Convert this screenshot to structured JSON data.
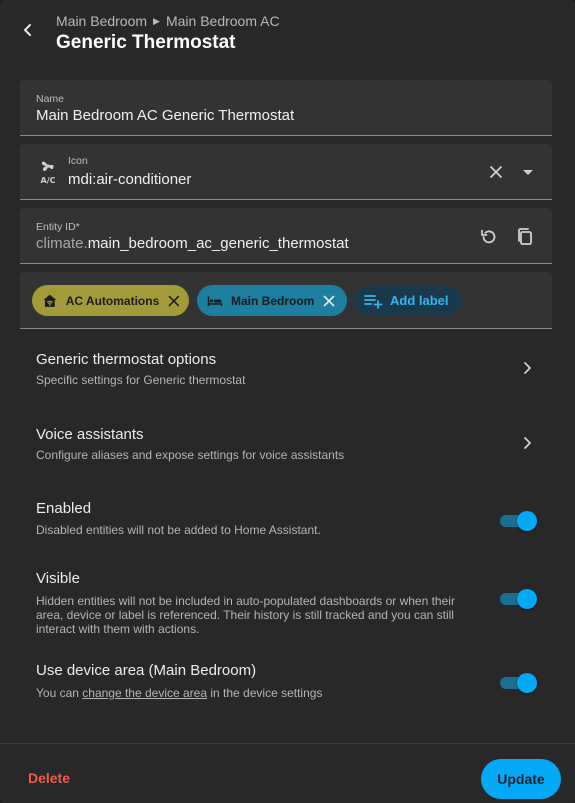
{
  "header": {
    "breadcrumb": [
      "Main Bedroom",
      "Main Bedroom AC"
    ],
    "title": "Generic Thermostat"
  },
  "name_field": {
    "label": "Name",
    "value": "Main Bedroom AC Generic Thermostat"
  },
  "icon_field": {
    "label": "Icon",
    "value": "mdi:air-conditioner",
    "icon": "air-conditioner-icon"
  },
  "entity_field": {
    "label": "Entity ID*",
    "prefix": "climate.",
    "value": "main_bedroom_ac_generic_thermostat"
  },
  "labels": {
    "chips": [
      {
        "label": "AC Automations",
        "icon": "home-automation-icon",
        "color": "#a39a3a"
      },
      {
        "label": "Main Bedroom",
        "icon": "bed-icon",
        "color": "#1d7fa0"
      }
    ],
    "add_label": "Add label"
  },
  "rows": {
    "generic": {
      "title": "Generic thermostat options",
      "subtitle": "Specific settings for Generic thermostat"
    },
    "voice": {
      "title": "Voice assistants",
      "subtitle": "Configure aliases and expose settings for voice assistants"
    }
  },
  "toggles": {
    "enabled": {
      "title": "Enabled",
      "subtitle": "Disabled entities will not be added to Home Assistant.",
      "on": true
    },
    "visible": {
      "title": "Visible",
      "subtitle": "Hidden entities will not be included in auto-populated dashboards or when their area, device or label is referenced. Their history is still tracked and you can still interact with them with actions.",
      "on": true
    },
    "area": {
      "title": "Use device area (Main Bedroom)",
      "subtitle_pre": "You can ",
      "subtitle_link": "change the device area",
      "subtitle_post": " in the device settings",
      "on": true
    }
  },
  "footer": {
    "delete": "Delete",
    "update": "Update"
  },
  "colors": {
    "accent": "#03a9f4",
    "danger": "#f25a4f",
    "surface": "#282828",
    "field": "#333333"
  }
}
